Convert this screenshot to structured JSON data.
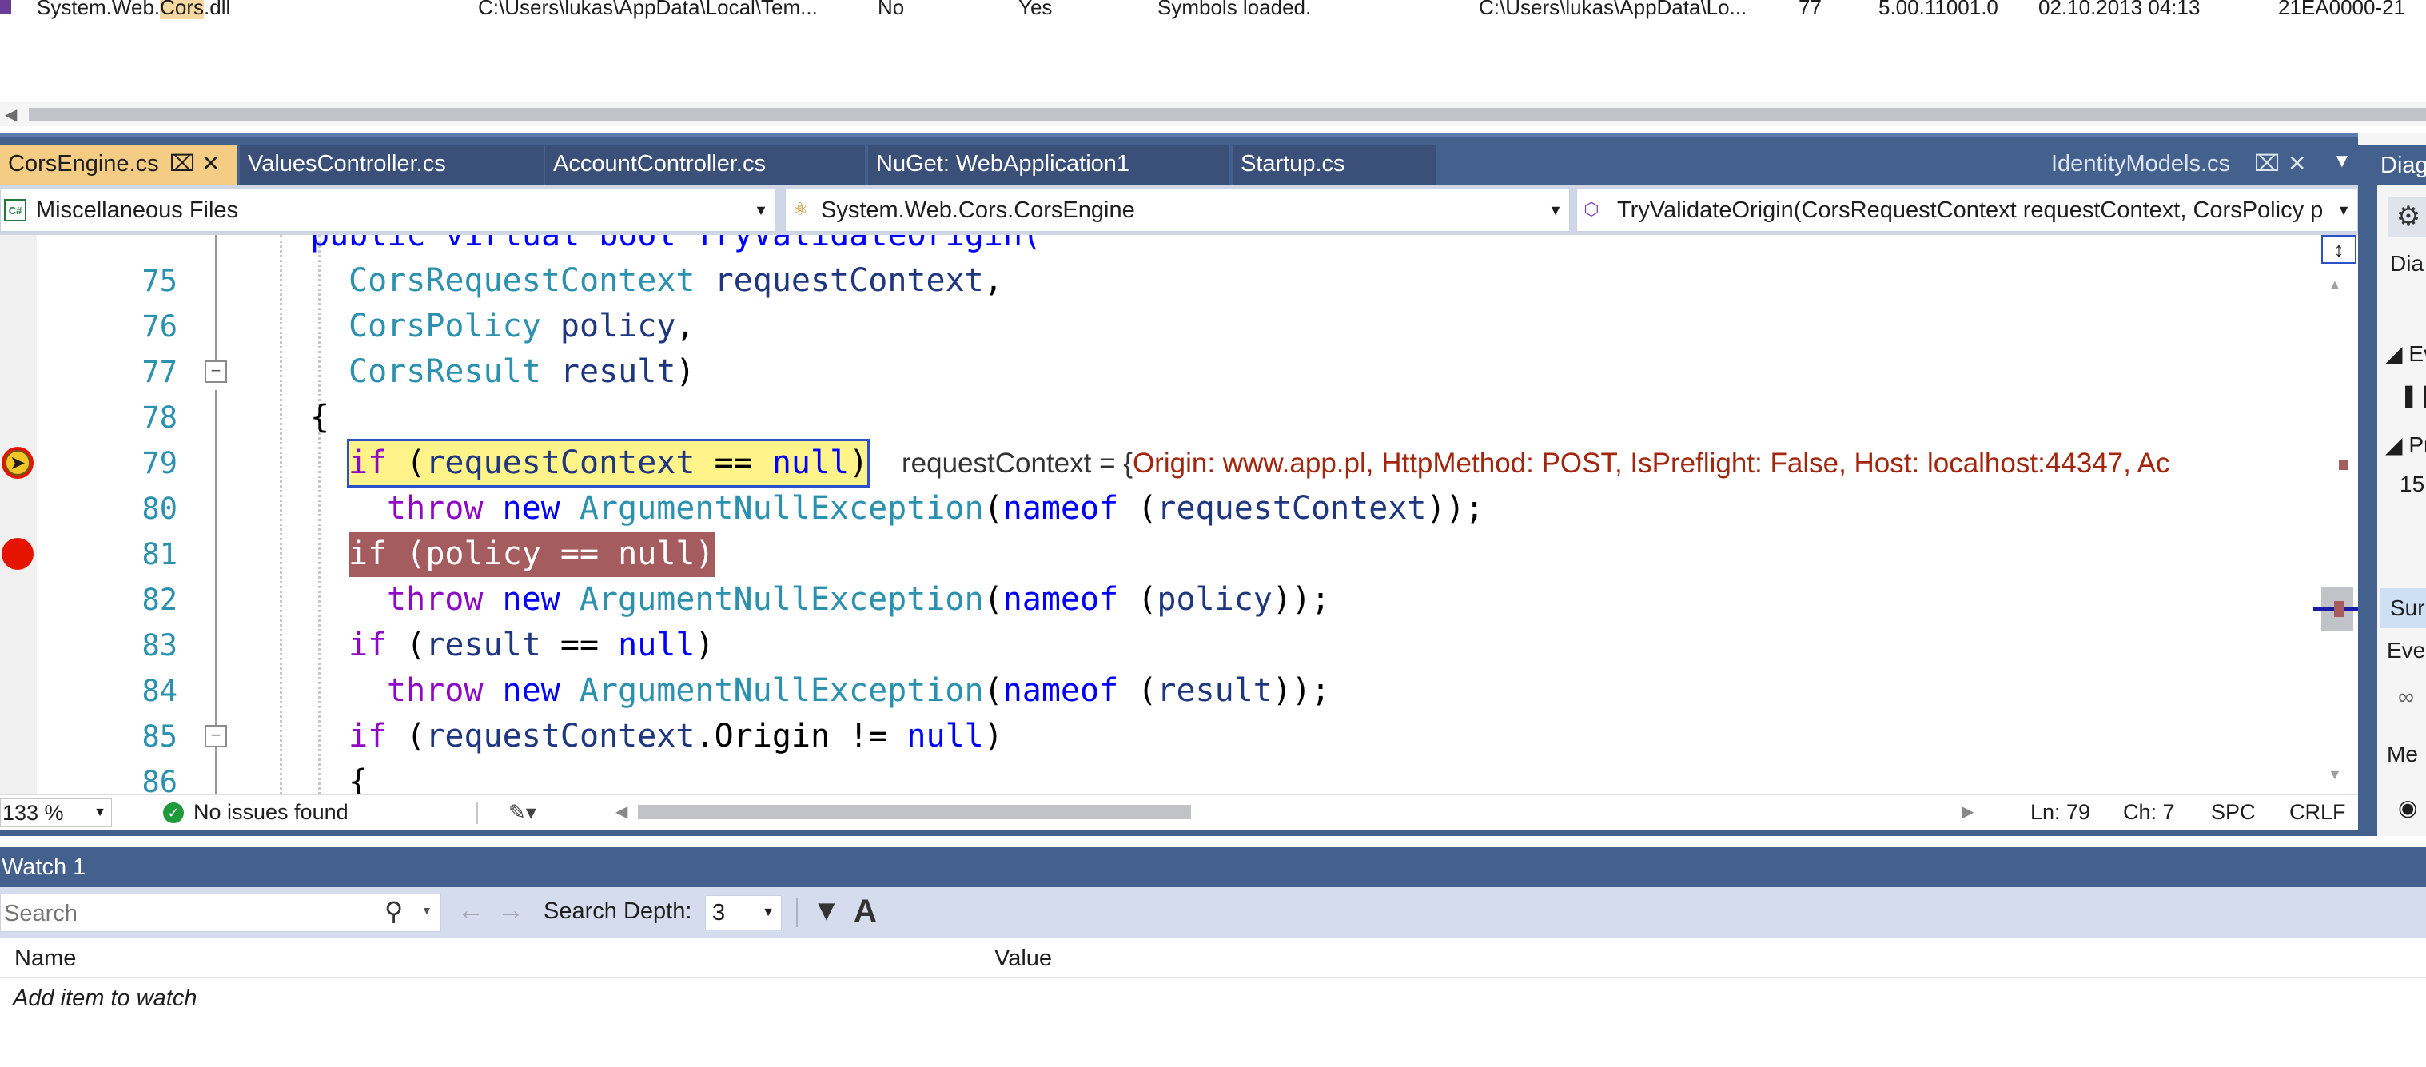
{
  "modules_row": {
    "name_prefix": "System.Web.",
    "name_highlight": "Cors",
    "name_suffix": ".dll",
    "path": "C:\\Users\\lukas\\AppData\\Local\\Tem...",
    "optimized": "No",
    "user_code": "Yes",
    "symbol_status": "Symbols loaded.",
    "symbol_file": "C:\\Users\\lukas\\AppData\\Lo...",
    "order": "77",
    "version": "5.00.11001.0",
    "timestamp": "02.10.2013 04:13",
    "address": "21EA0000-21"
  },
  "tabs": {
    "active": "CorsEngine.cs",
    "others": [
      "ValuesController.cs",
      "AccountController.cs",
      "NuGet: WebApplication1",
      "Startup.cs"
    ],
    "right": "IdentityModels.cs"
  },
  "nav_bar": {
    "project": "Miscellaneous Files",
    "type": "System.Web.Cors.CorsEngine",
    "member": "TryValidateOrigin(CorsRequestContext requestContext, CorsPolicy p"
  },
  "code": {
    "partial_top_line": "public virtual bool TryValidateOrigin(",
    "line_numbers": [
      "75",
      "76",
      "77",
      "78",
      "79",
      "80",
      "81",
      "82",
      "83",
      "84",
      "85",
      "86"
    ],
    "datatip": {
      "name": "requestContext = {",
      "value": "Origin: www.app.pl, HttpMethod: POST, IsPreflight: False, Host: localhost:44347, Ac"
    }
  },
  "status_bar": {
    "zoom": "133 %",
    "issues": "No issues found",
    "line": "Ln: 79",
    "col": "Ch: 7",
    "indent": "SPC",
    "eol": "CRLF"
  },
  "diagnostics": {
    "title": "Diag",
    "items": [
      "Dia",
      "Ev",
      "Pr",
      "15",
      "Sur",
      "Eve",
      "Me"
    ]
  },
  "watch": {
    "title": "Watch 1",
    "search_placeholder": "Search",
    "depth_label": "Search Depth:",
    "depth_value": "3",
    "col_name": "Name",
    "col_value": "Value",
    "add_item": "Add item to watch"
  },
  "colors": {
    "tab_bar": "#44608c",
    "active_tab": "#f5cc84",
    "breakpoint": "#e51400",
    "current_statement": "#fff38a",
    "breakpoint_statement": "#a55c5f",
    "keyword": "#0000ff",
    "type": "#2b91af"
  }
}
